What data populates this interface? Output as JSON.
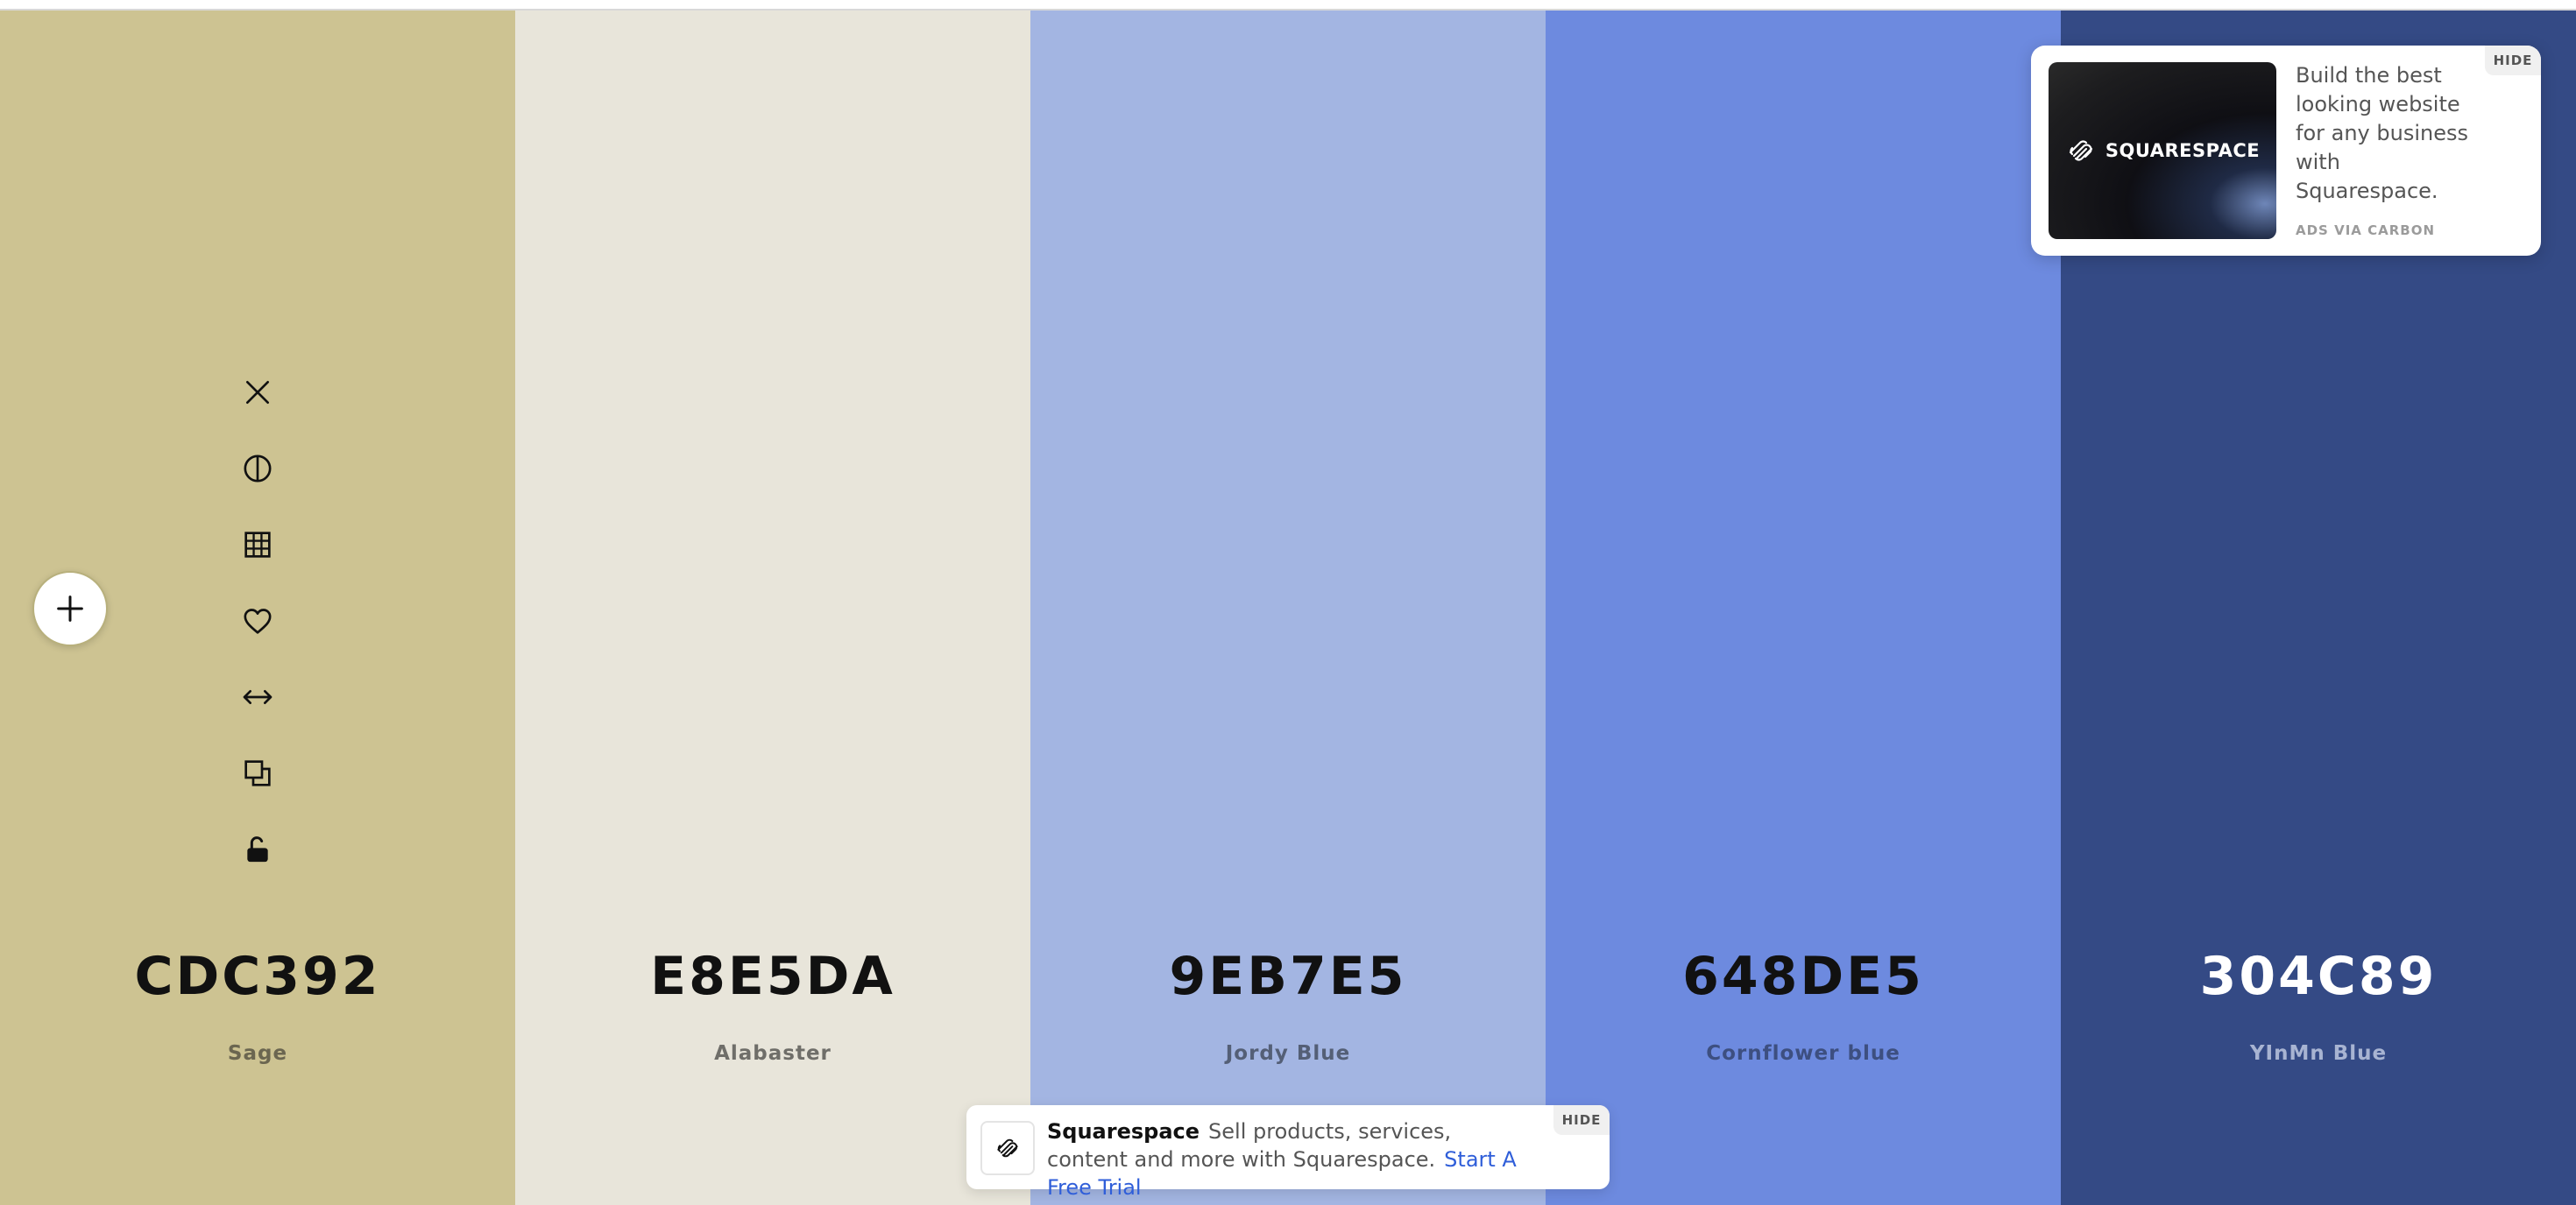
{
  "palette": {
    "colors": [
      {
        "hex": "CDC392",
        "name": "Sage",
        "bg": "#CDC392",
        "text_color": "#111111",
        "name_color": "#6b6650"
      },
      {
        "hex": "E8E5DA",
        "name": "Alabaster",
        "bg": "#E8E5DA",
        "text_color": "#111111",
        "name_color": "#6f6e69"
      },
      {
        "hex": "9EB7E5",
        "name": "Jordy Blue",
        "bg": "#A3B5E2",
        "text_color": "#111111",
        "name_color": "#545f76"
      },
      {
        "hex": "648DE5",
        "name": "Cornflower blue",
        "bg": "#6D8ADF",
        "text_color": "#111111",
        "name_color": "#3d4f80"
      },
      {
        "hex": "304C89",
        "name": "YInMn Blue",
        "bg": "#344A85",
        "text_color": "#ffffff",
        "name_color": "#a8b4d2"
      }
    ]
  },
  "tools": {
    "icons": [
      "close-icon",
      "contrast-icon",
      "grid-icon",
      "heart-icon",
      "drag-arrows-icon",
      "copy-icon",
      "unlock-icon"
    ]
  },
  "add_button": {
    "icon": "plus-icon"
  },
  "ad": {
    "logo_text": "SQUARESPACE",
    "text": "Build the best looking website for any business with Squarespace.",
    "via": "ADS VIA CARBON",
    "hide_label": "HIDE"
  },
  "bottom_ad": {
    "brand": "Squarespace",
    "text": "Sell products, services, content and more with Squarespace.",
    "cta": "Start A Free Trial",
    "hide_label": "HIDE"
  }
}
